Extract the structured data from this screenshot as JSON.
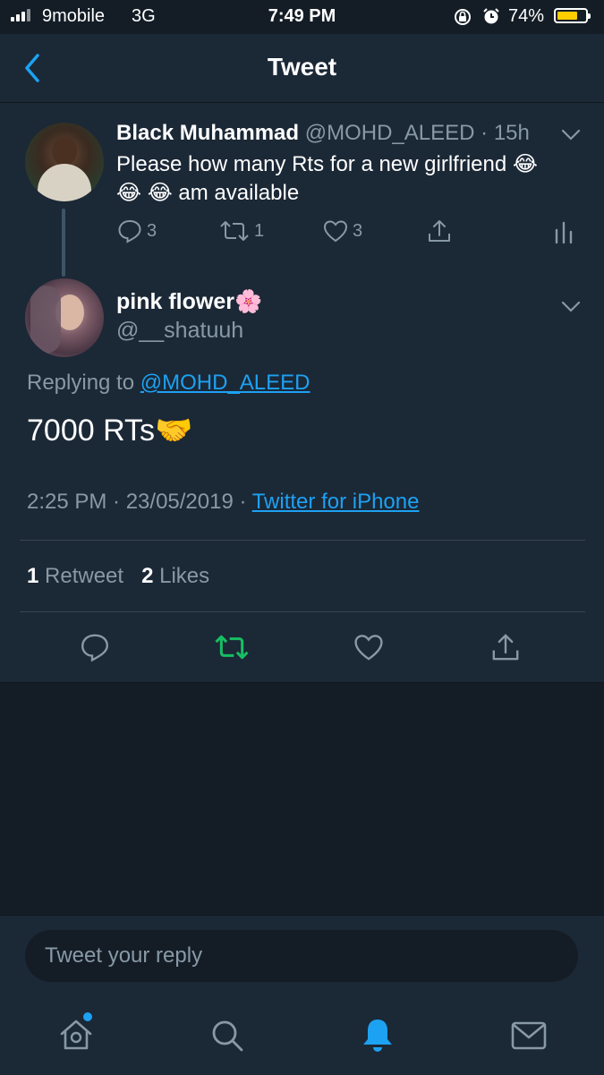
{
  "status_bar": {
    "carrier": "9mobile",
    "network": "3G",
    "time": "7:49 PM",
    "battery_percent": "74%",
    "battery_level": 0.74
  },
  "header": {
    "title": "Tweet",
    "back_icon": "chevron-left-icon"
  },
  "parent_tweet": {
    "display_name": "Black Muhammad",
    "handle": "@MOHD_ALEED",
    "time": "· 15h",
    "text_line1": "Please how many Rts for a new girlfriend 😂",
    "text_line2": "😂 😂  am available",
    "reply_count": "3",
    "retweet_count": "1",
    "like_count": "3"
  },
  "main_tweet": {
    "display_name": "pink flower🌸",
    "handle": "@__shatuuh",
    "replying_to_label": "Replying to",
    "replying_to_handle": "@MOHD_ALEED",
    "text": "7000 RTs🤝",
    "timestamp": "2:25 PM · 23/05/2019 ·",
    "source": "Twitter for iPhone",
    "retweets_count": "1",
    "retweets_label": "Retweet",
    "likes_count": "2",
    "likes_label": "Likes"
  },
  "composer": {
    "placeholder": "Tweet your reply"
  },
  "colors": {
    "background": "#141d26",
    "surface": "#1b2836",
    "accent": "#1da1f2",
    "retweet_green": "#17bf63",
    "muted": "#8899a6"
  }
}
